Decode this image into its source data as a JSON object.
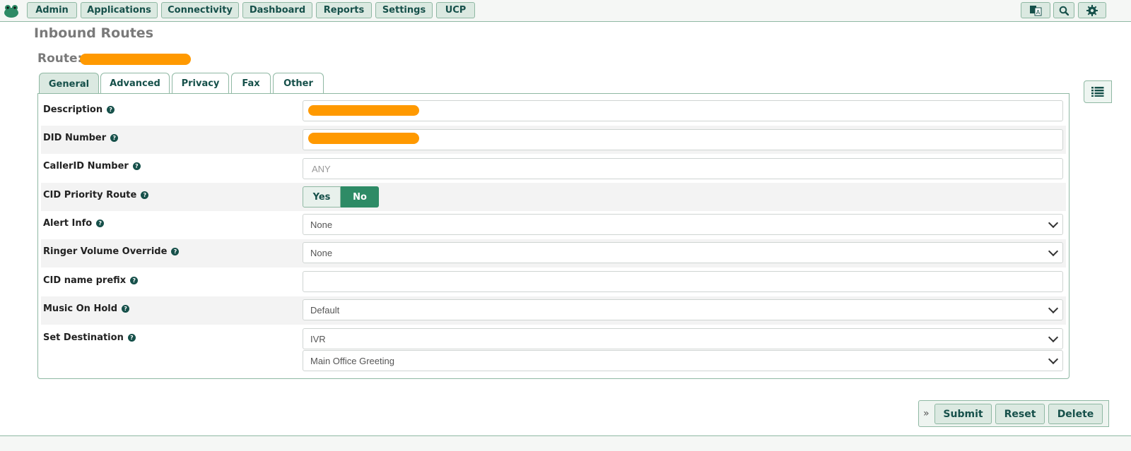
{
  "nav": {
    "items": [
      "Admin",
      "Applications",
      "Connectivity",
      "Dashboard",
      "Reports",
      "Settings",
      "UCP"
    ],
    "icons": [
      "translate-icon",
      "search-icon",
      "gear-icon"
    ]
  },
  "page": {
    "title": "Inbound Routes",
    "route_label": "Route:"
  },
  "tabs": [
    "General",
    "Advanced",
    "Privacy",
    "Fax",
    "Other"
  ],
  "form": {
    "description": {
      "label": "Description",
      "value": ""
    },
    "did_number": {
      "label": "DID Number",
      "value": ""
    },
    "callerid_number": {
      "label": "CallerID Number",
      "placeholder": "ANY"
    },
    "cid_priority_route": {
      "label": "CID Priority Route",
      "yes": "Yes",
      "no": "No",
      "selected": "No"
    },
    "alert_info": {
      "label": "Alert Info",
      "value": "None"
    },
    "ringer_volume_override": {
      "label": "Ringer Volume Override",
      "value": "None"
    },
    "cid_name_prefix": {
      "label": "CID name prefix",
      "value": ""
    },
    "music_on_hold": {
      "label": "Music On Hold",
      "value": "Default"
    },
    "set_destination": {
      "label": "Set Destination",
      "type": "IVR",
      "target": "Main Office Greeting"
    }
  },
  "actions": {
    "collapse": "»",
    "submit": "Submit",
    "reset": "Reset",
    "delete": "Delete"
  },
  "colors": {
    "accent": "#2e8b66",
    "redaction": "#ff9900",
    "button_bg": "#dbe9e1"
  }
}
